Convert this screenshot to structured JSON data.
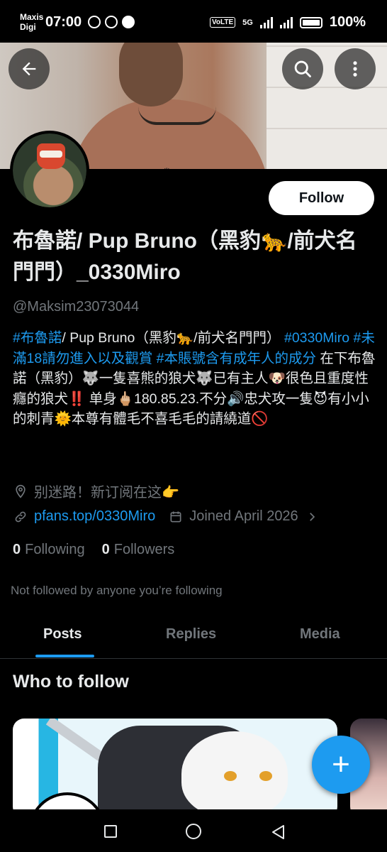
{
  "status_bar": {
    "carrier_top": "Maxis",
    "carrier_bottom": "Digi",
    "time": "07:00",
    "volte": "VoLTE",
    "network": "5G",
    "battery": "100%"
  },
  "header": {
    "back_icon": "arrow-left-icon",
    "search_icon": "search-icon",
    "more_icon": "more-vertical-icon"
  },
  "profile": {
    "follow_label": "Follow",
    "display_name": "布魯諾/ Pup Bruno（黑豹🐆/前犬名門門）_0330Miro",
    "handle": "@Maksim23073044",
    "bio": {
      "tag1": "#布魯諾",
      "text1": "/ Pup Bruno（黑豹🐆/前犬名門門）",
      "tag2": "#0330Miro",
      "tag3": "#未滿18請勿進入以及觀賞",
      "tag4": "#本賬號含有成年人的成分",
      "text2": " 在下布魯諾（黑豹）🐺一隻喜熊的狼犬🐺已有主人🐶很色且重度性癮的狼犬‼️ 单身🖕🏼180.85.23.不分🔊忠犬攻一隻😈有小小的刺青🌞本尊有體毛不喜毛毛的請繞道🚫"
    },
    "location": "别迷路！新订阅在这👉",
    "link": "pfans.top/0330Miro",
    "joined": "Joined April 2026",
    "following_count": "0",
    "following_label": "Following",
    "followers_count": "0",
    "followers_label": "Followers",
    "not_followed_text": "Not followed by anyone you’re following"
  },
  "tabs": [
    {
      "label": "Posts",
      "active": true
    },
    {
      "label": "Replies",
      "active": false
    },
    {
      "label": "Media",
      "active": false
    }
  ],
  "who_to_follow": {
    "title": "Who to follow"
  },
  "fab": {
    "label": "+"
  },
  "colors": {
    "accent": "#1d9bf0",
    "background": "#000000",
    "text_primary": "#e7e9ea",
    "text_secondary": "#71767b"
  }
}
